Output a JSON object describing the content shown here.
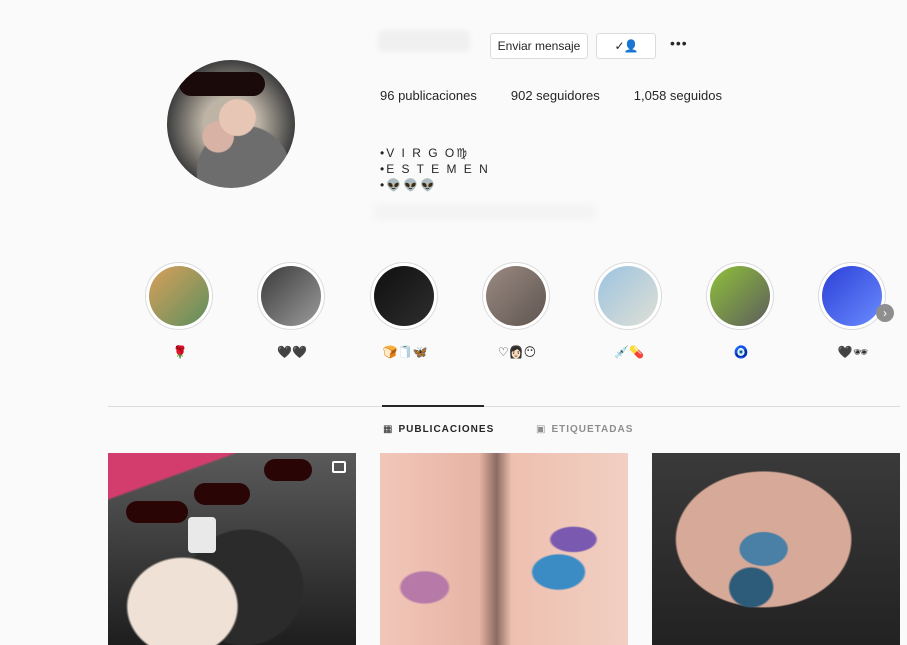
{
  "profile": {
    "buttons": {
      "message": "Enviar mensaje",
      "follow_icon": "person-check-icon",
      "more_icon": "more-dots-icon",
      "more_glyph": "•••"
    },
    "stats": {
      "posts": "96 publicaciones",
      "followers": "902 seguidores",
      "following": "1,058 seguidos"
    },
    "bio": {
      "line1": "•V I R G O♍",
      "line2": "•E S T E M E N",
      "line3": "•👽👽👽"
    }
  },
  "highlights": [
    {
      "label": "🌹",
      "colors": [
        "#d9a05a",
        "#5c8f5e"
      ]
    },
    {
      "label": "🖤🖤",
      "colors": [
        "#3a3a3a",
        "#9c9c9c"
      ]
    },
    {
      "label": "🍞🧻🦋",
      "colors": [
        "#0f0f0f",
        "#2e2e2e"
      ]
    },
    {
      "label": "♡👩🏻😶",
      "colors": [
        "#9a8a82",
        "#5f5550"
      ]
    },
    {
      "label": "💉💊",
      "colors": [
        "#9bc3df",
        "#e0e0d6"
      ]
    },
    {
      "label": "🧿",
      "colors": [
        "#8fc13a",
        "#5d5d5d"
      ]
    },
    {
      "label": "🖤🕶",
      "colors": [
        "#2c3fd6",
        "#6a8cff"
      ]
    }
  ],
  "highlights_next_glyph": "›",
  "tabs": {
    "posts": {
      "label": "PUBLICACIONES",
      "icon": "grid-icon",
      "glyph": "▦"
    },
    "tagged": {
      "label": "ETIQUETADAS",
      "icon": "tag-person-icon",
      "glyph": "▣"
    }
  },
  "colors": {
    "border": "#dbdbdb",
    "text": "#262626",
    "muted": "#8e8e8e",
    "background": "#fafafa"
  }
}
